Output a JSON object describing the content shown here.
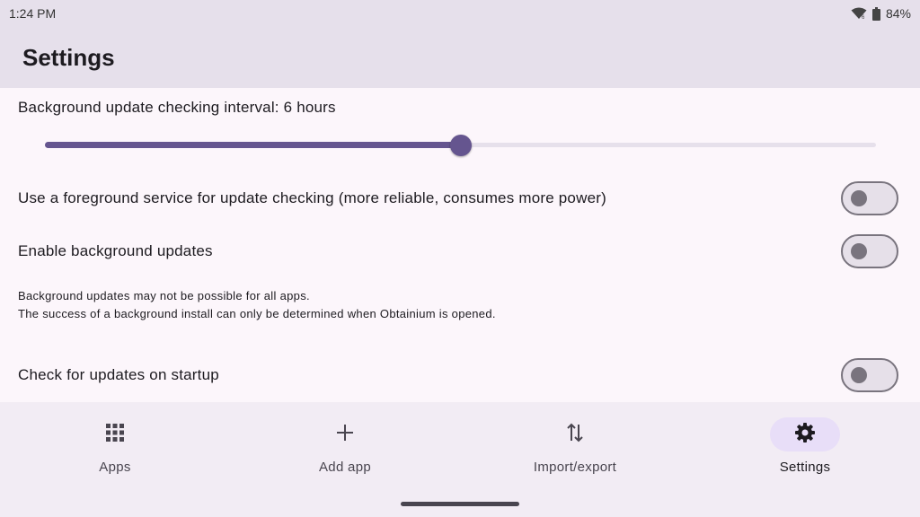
{
  "status": {
    "time": "1:24 PM",
    "battery": "84%",
    "wifi_icon": "wifi-icon",
    "battery_icon": "battery-icon"
  },
  "app_bar": {
    "title": "Settings"
  },
  "settings": {
    "interval_label": "Background update checking interval: 6 hours",
    "interval_slider_fraction": 0.5,
    "foreground_service_label": "Use a foreground service for update checking (more reliable, consumes more power)",
    "foreground_service_on": false,
    "background_updates_label": "Enable background updates",
    "background_updates_on": false,
    "note_line1": "Background updates may not be possible for all apps.",
    "note_line2": "The success of a background install can only be determined when Obtainium is opened.",
    "startup_check_label": "Check for updates on startup",
    "startup_check_on": false
  },
  "nav": {
    "items": [
      {
        "label": "Apps",
        "icon": "grid-icon",
        "active": false
      },
      {
        "label": "Add app",
        "icon": "plus-icon",
        "active": false
      },
      {
        "label": "Import/export",
        "icon": "swap-vertical-icon",
        "active": false
      },
      {
        "label": "Settings",
        "icon": "gear-icon",
        "active": true
      }
    ]
  },
  "colors": {
    "accent": "#65558f",
    "surface": "#fcf6fb",
    "app_bar": "#e6e0eb",
    "nav_bar": "#f2ecf4",
    "active_indicator": "#e8def8"
  }
}
